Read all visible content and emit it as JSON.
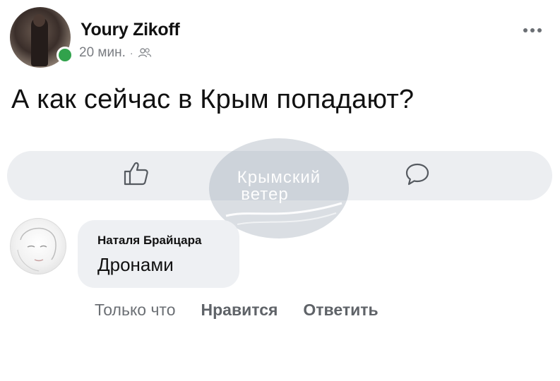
{
  "post": {
    "author": "Youry Zikoff",
    "time": "20 мин.",
    "separator": "·",
    "audience_icon": "friends-icon",
    "more_icon": "more-options-icon",
    "text": "А как сейчас в Крым попадают?",
    "online_color": "#31a24c"
  },
  "actions": {
    "like_icon": "thumbs-up-icon",
    "comment_icon": "comment-bubble-icon"
  },
  "watermark": {
    "line1": "Крымский",
    "line2": "ветер"
  },
  "comment": {
    "author": "Наталя Брайцара",
    "text": "Дронами",
    "time": "Только что",
    "like_label": "Нравится",
    "reply_label": "Ответить"
  }
}
